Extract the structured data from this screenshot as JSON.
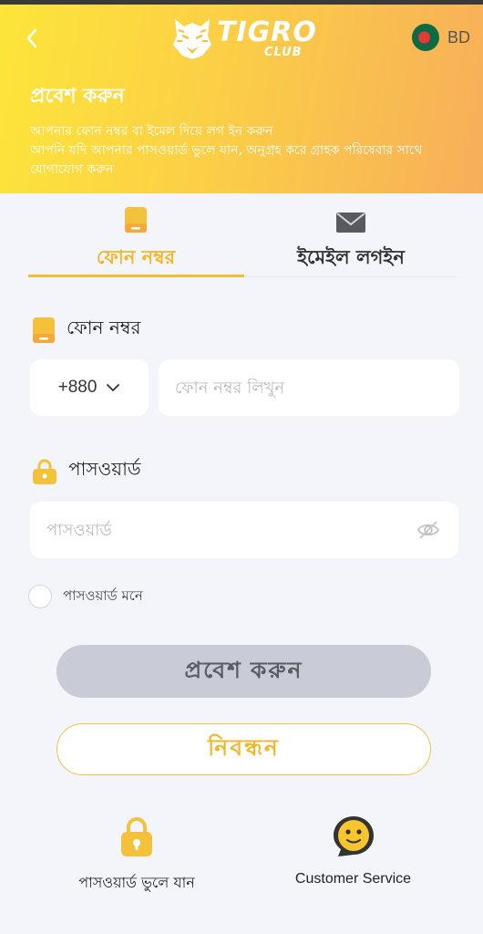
{
  "header": {
    "back_icon": "chevron-left-icon",
    "logo": {
      "main": "TIGRO",
      "sub": "CLUB"
    },
    "language": {
      "flag_icon": "bangladesh-flag-icon",
      "label": "BD"
    },
    "title": "প্রবেশ করুন",
    "description_line1": "আপনার ফোন নম্বর বা ইমেল দিয়ে লগ ইন করুন",
    "description_line2": "আপনি যদি আপনার পাসওয়ার্ড ভুলে যান, অনুগ্রহ করে গ্রাহক পরিষেবার সাথে যোগাযোগ করুন"
  },
  "tabs": [
    {
      "label": "ফোন নম্বর",
      "icon": "phone-icon",
      "active": true
    },
    {
      "label": "ইমেইল লগইন",
      "icon": "mail-icon",
      "active": false
    }
  ],
  "form": {
    "phone_label": "ফোন নম্বর",
    "country_code": "+880",
    "phone_placeholder": "ফোন নম্বর লিখুন",
    "password_label": "পাসওয়ার্ড",
    "password_placeholder": "পাসওয়ার্ড",
    "remember_label": "পাসওয়ার্ড মনে"
  },
  "buttons": {
    "login": "প্রবেশ করুন",
    "register": "নিবন্ধন"
  },
  "footer": {
    "forgot_password": "পাসওয়ার্ড ভুলে যান",
    "customer_service": "Customer Service"
  },
  "colors": {
    "accent": "#f1b82d",
    "header_gradient_start": "#fde53a",
    "header_gradient_end": "#f7ae5a",
    "login_button_bg": "#c9ccd6"
  }
}
